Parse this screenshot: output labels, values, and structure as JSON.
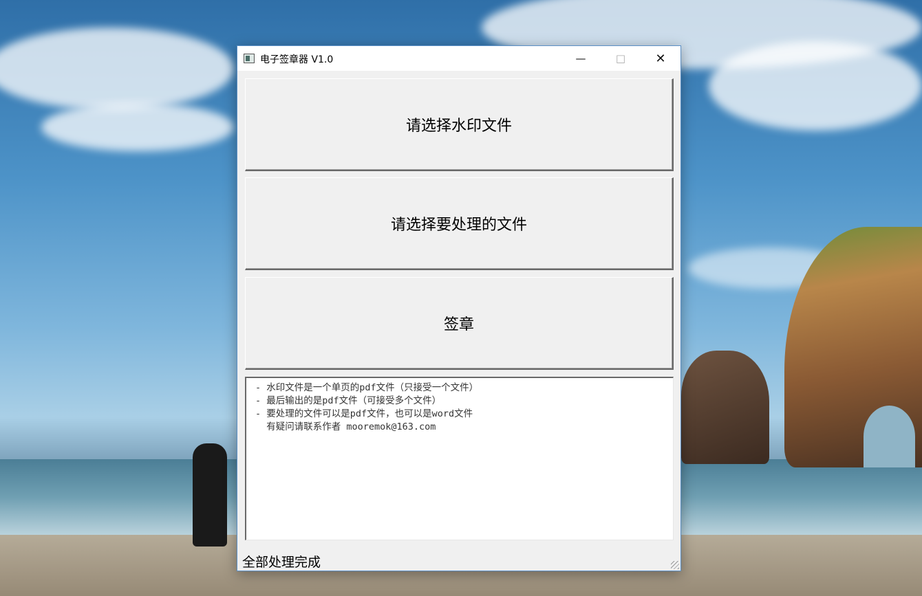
{
  "window": {
    "title": "电子签章器 V1.0",
    "controls": {
      "minimize": "—",
      "maximize": "□",
      "close": "✕"
    }
  },
  "buttons": {
    "select_watermark": "请选择水印文件",
    "select_files": "请选择要处理的文件",
    "sign": "签章"
  },
  "info": {
    "lines": [
      "- 水印文件是一个单页的pdf文件（只接受一个文件）",
      "- 最后输出的是pdf文件（可接受多个文件）",
      "- 要处理的文件可以是pdf文件，也可以是word文件",
      "",
      "  有疑问请联系作者 mooremok@163.com"
    ]
  },
  "status": "全部处理完成",
  "icons": [
    "app-icon",
    "minimize-icon",
    "maximize-icon",
    "close-icon",
    "resize-grip-icon"
  ]
}
